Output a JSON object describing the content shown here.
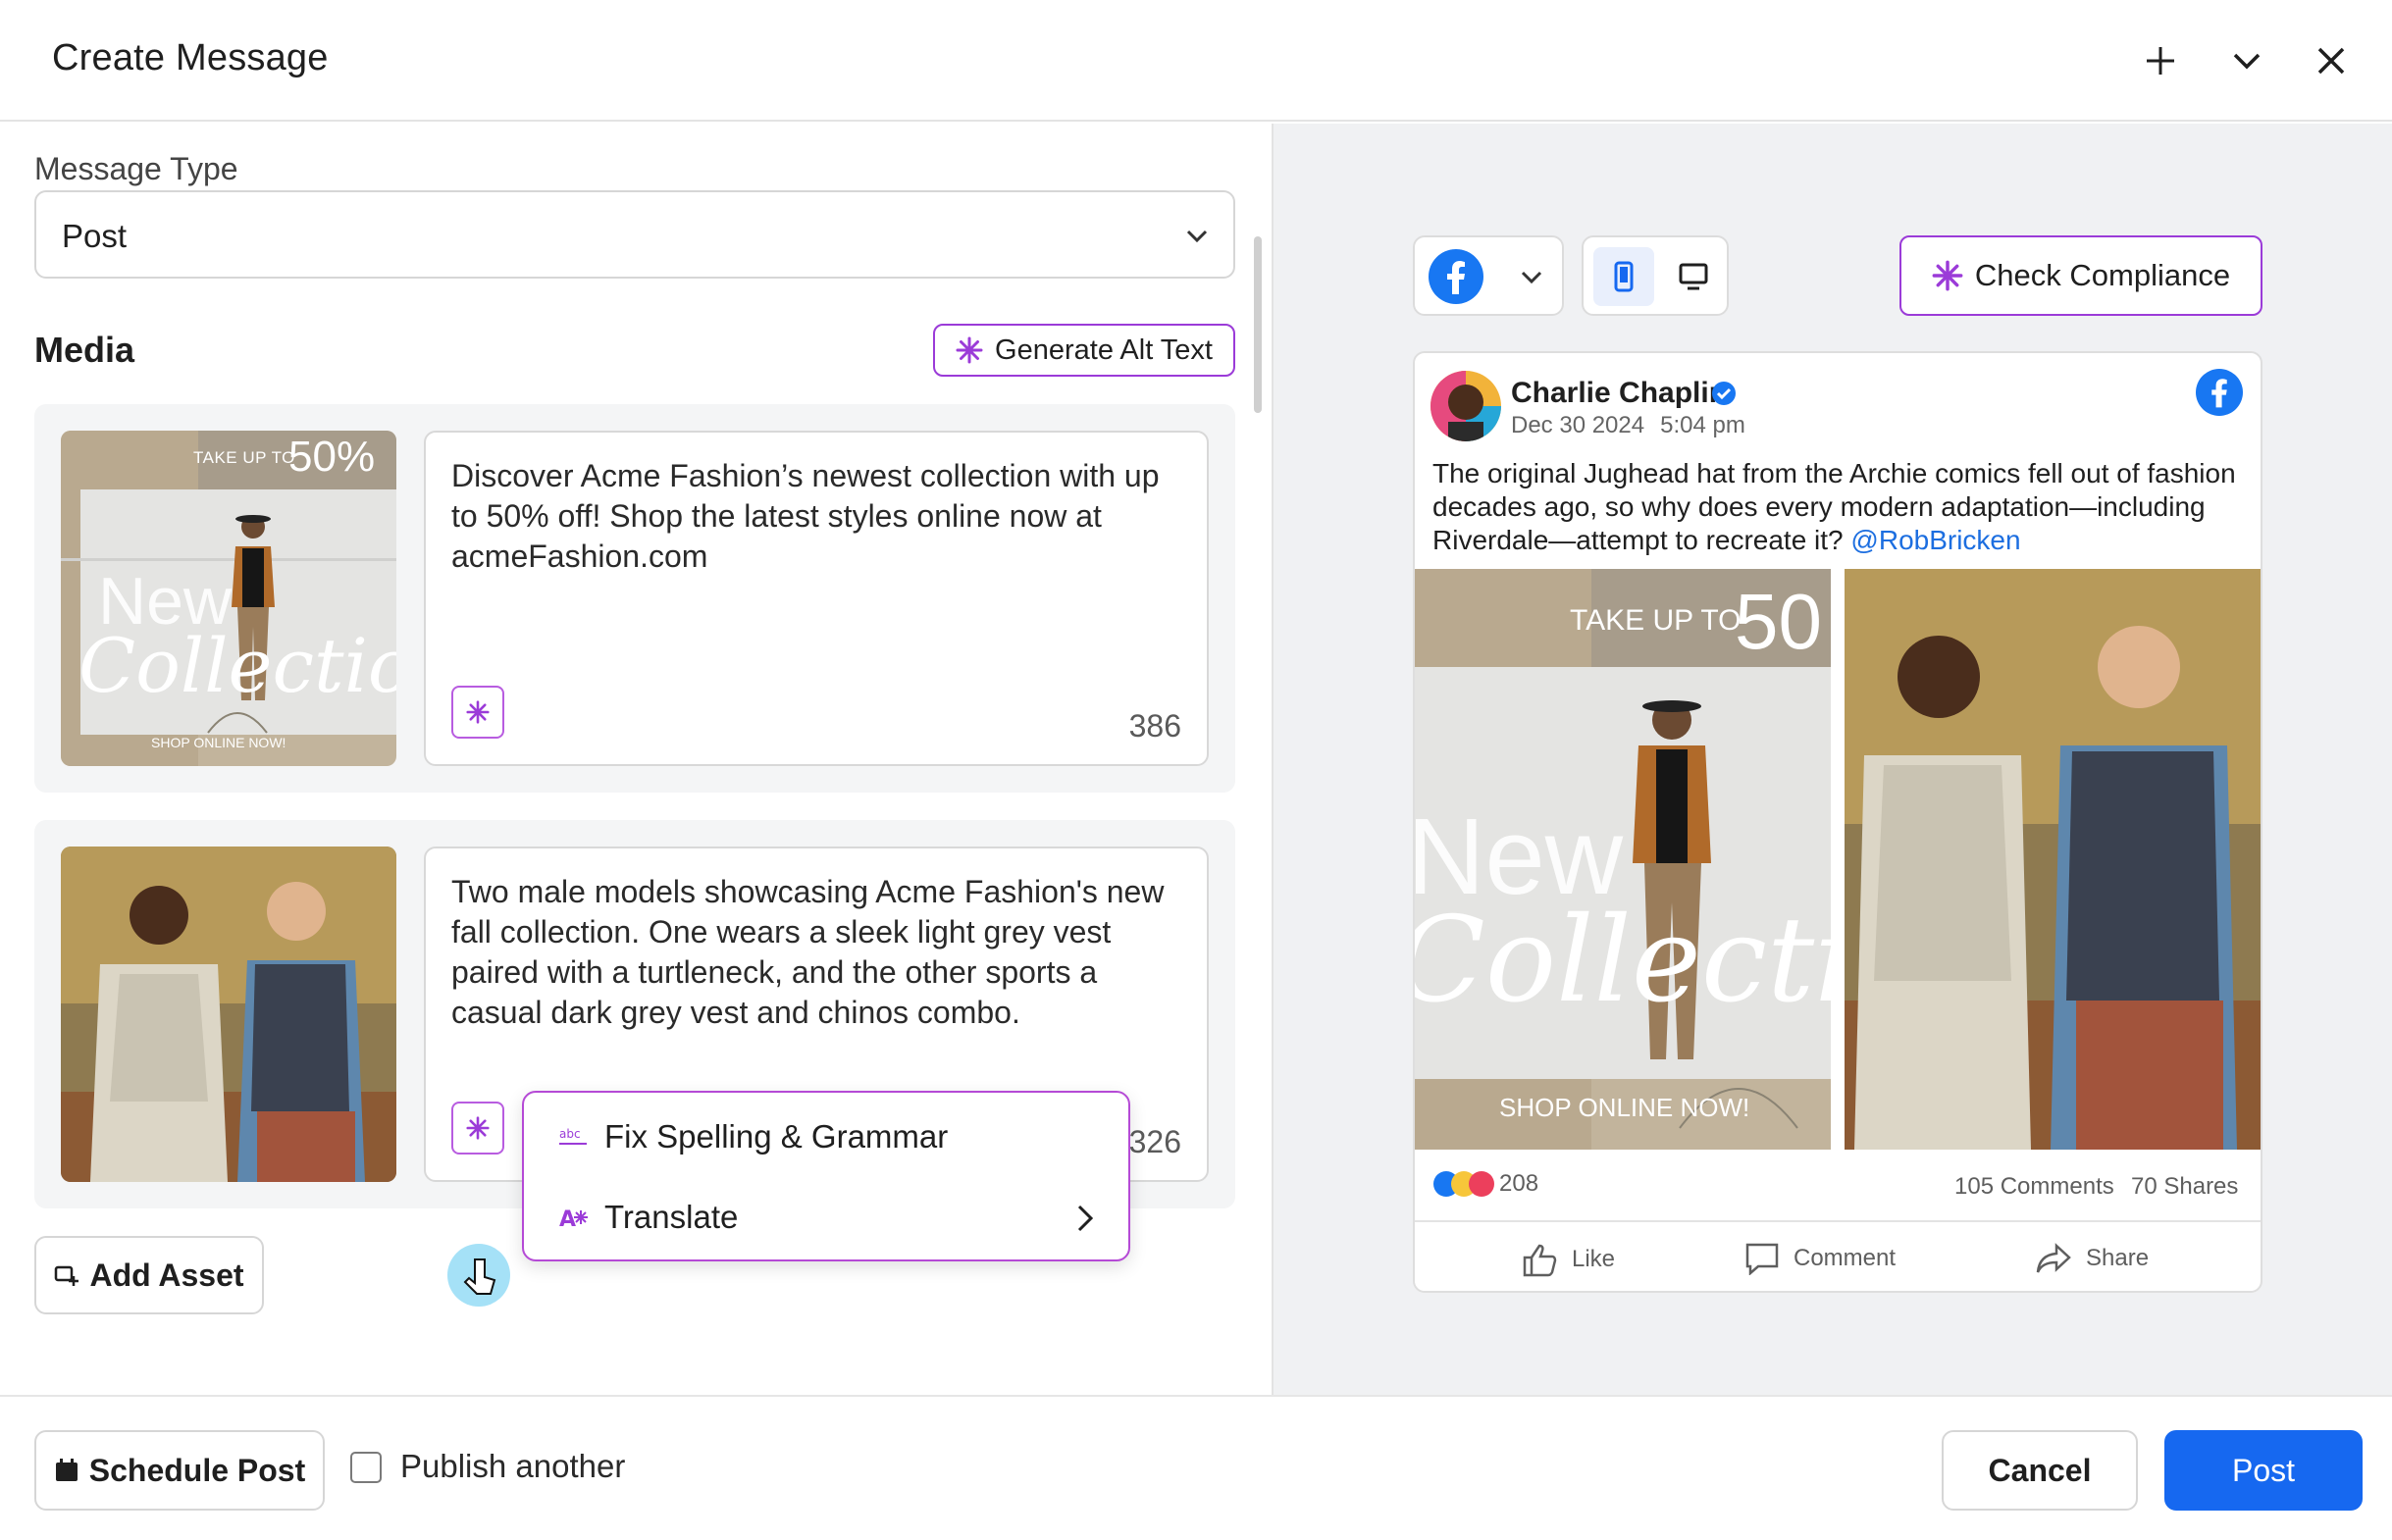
{
  "header": {
    "title": "Create Message"
  },
  "message_type": {
    "label": "Message Type",
    "value": "Post"
  },
  "media": {
    "heading": "Media",
    "generate_alt_text": "Generate Alt Text",
    "assets": [
      {
        "alt_text": "Discover Acme Fashion’s newest collection with up to 50% off! Shop the latest styles online now at acmeFashion.com",
        "count": "386",
        "image_text": {
          "take": "TAKE UP TO",
          "pct": "50%",
          "new": "New",
          "coll": "Collection",
          "shop": "SHOP ONLINE NOW!"
        }
      },
      {
        "alt_text": "Two male models showcasing Acme Fashion's new fall collection. One wears a sleek light grey vest paired with a turtleneck, and the other sports a casual dark grey vest and chinos combo.",
        "count": "326"
      }
    ],
    "add_asset": "Add Asset"
  },
  "ai_menu": {
    "items": [
      {
        "label": "Fix Spelling & Grammar",
        "icon": "abc"
      },
      {
        "label": "Translate",
        "icon": "A*"
      }
    ]
  },
  "preview": {
    "check_compliance": "Check Compliance",
    "author": "Charlie Chaplin",
    "date": "Dec 30 2024",
    "time": "5:04 pm",
    "text": "The original Jughead hat from the Archie comics fell out of fashion decades ago, so why does every modern adaptation—including Riverdale—attempt to recreate it?",
    "mention": "@RobBricken",
    "image_text": {
      "take": "TAKE UP TO",
      "pct": "50",
      "new": "New",
      "coll": "Collectio",
      "shop": "SHOP ONLINE NOW!"
    },
    "reactions": "208",
    "comments": "105 Comments",
    "shares": "70 Shares",
    "actions": {
      "like": "Like",
      "comment": "Comment",
      "share": "Share"
    }
  },
  "footer": {
    "schedule": "Schedule Post",
    "publish_another": "Publish another",
    "cancel": "Cancel",
    "post": "Post"
  },
  "colors": {
    "primary": "#1668f0",
    "ai_accent": "#9b3bd8",
    "facebook": "#1877f2"
  }
}
